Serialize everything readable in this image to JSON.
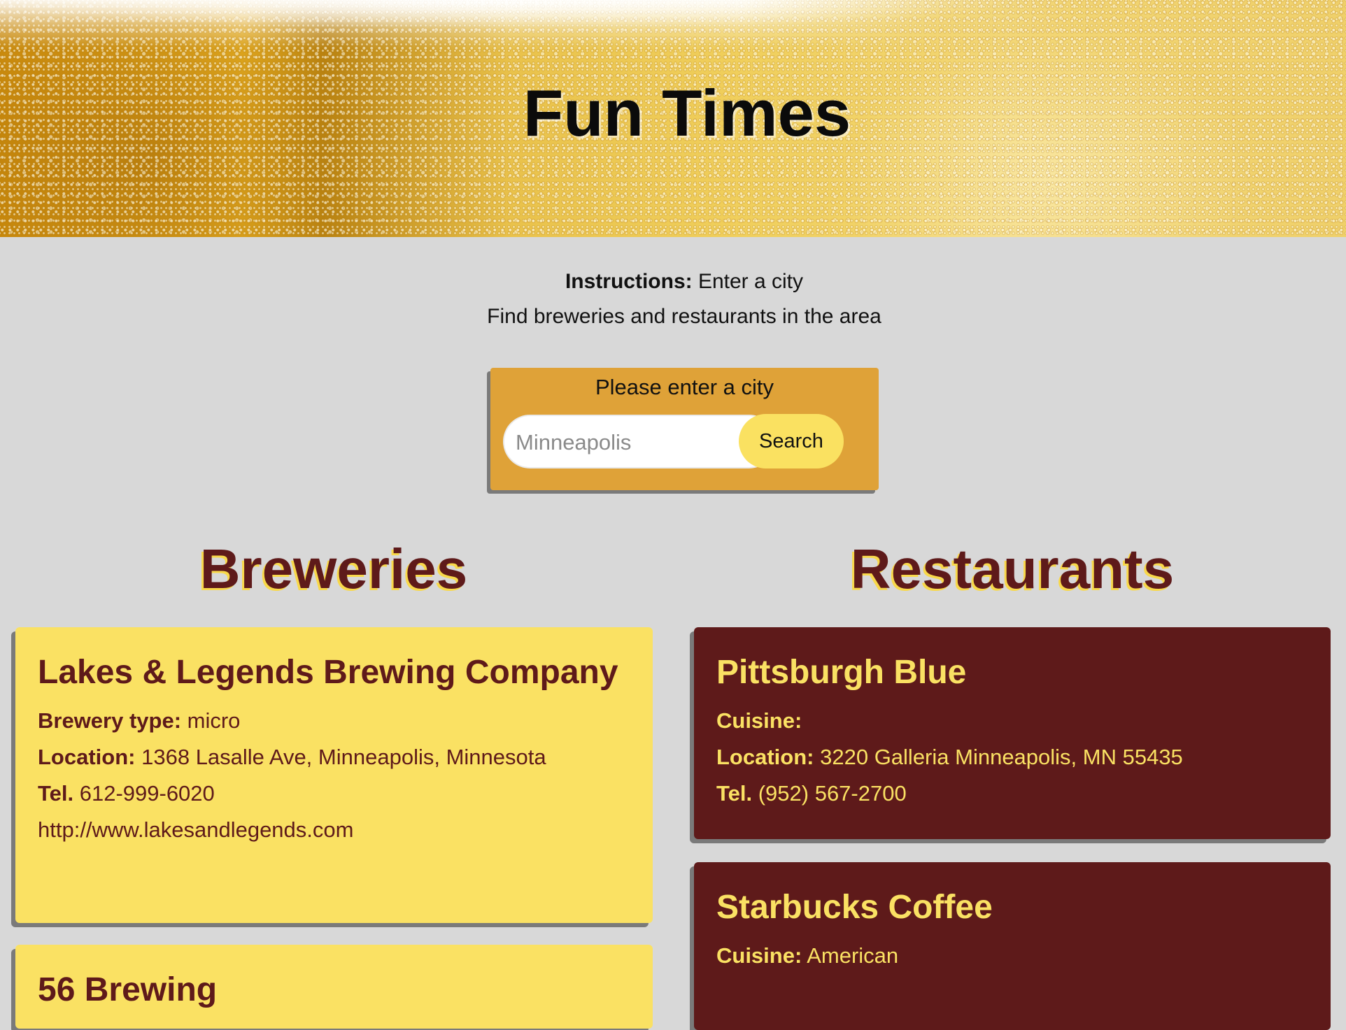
{
  "header": {
    "title": "Fun Times"
  },
  "instructions": {
    "label": "Instructions:",
    "text": " Enter a city",
    "subtext": "Find breweries and restaurants in the area"
  },
  "search": {
    "label": "Please enter a city",
    "placeholder": "Minneapolis",
    "button_label": "Search"
  },
  "breweries": {
    "heading": "Breweries",
    "items": [
      {
        "name": "Lakes & Legends Brewing Company",
        "type_label": "Brewery type:",
        "type": " micro",
        "location_label": "Location:",
        "location": " 1368 Lasalle Ave, Minneapolis, Minnesota",
        "tel_label": "Tel.",
        "tel": " 612-999-6020",
        "url": "http://www.lakesandlegends.com"
      },
      {
        "name": "56 Brewing"
      }
    ]
  },
  "restaurants": {
    "heading": "Restaurants",
    "items": [
      {
        "name": "Pittsburgh Blue",
        "cuisine_label": "Cuisine:",
        "cuisine": "",
        "location_label": "Location:",
        "location": " 3220 Galleria Minneapolis, MN 55435",
        "tel_label": "Tel.",
        "tel": " (952) 567-2700"
      },
      {
        "name": "Starbucks Coffee",
        "cuisine_label": "Cuisine:",
        "cuisine": " American"
      }
    ]
  },
  "colors": {
    "page_background": "#d8d8d8",
    "search_panel": "#dfa238",
    "button": "#fae161",
    "brewery_card": "#fae163",
    "restaurant_card": "#5e1a1a",
    "heading_text": "#5e1a1a",
    "heading_outline": "#f8d84a"
  },
  "icons": {
    "hero_background": "beer-foam-image",
    "input_autofill": "contact-card-icon"
  }
}
